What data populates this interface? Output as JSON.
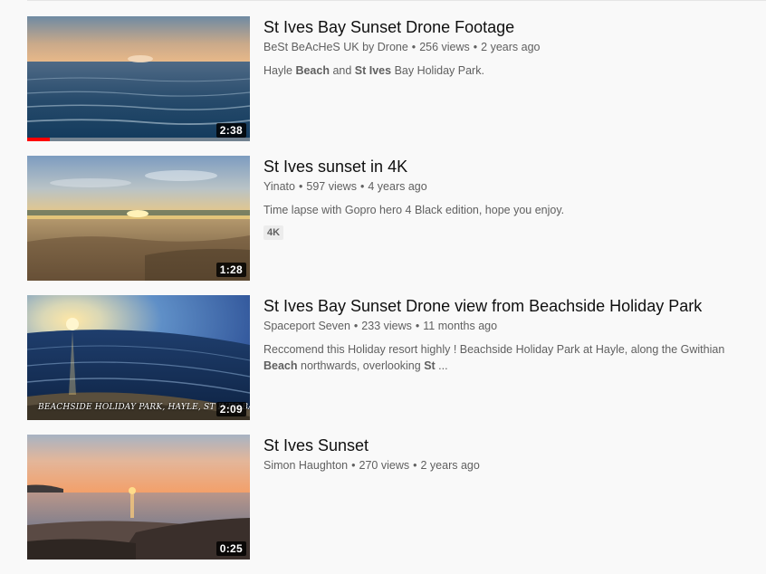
{
  "results": [
    {
      "title": "St Ives Bay Sunset Drone Footage",
      "channel": "BeSt BeAcHeS UK by Drone",
      "views": "256 views",
      "age": "2 years ago",
      "duration": "2:38",
      "watch_progress": 0.1,
      "description": [
        {
          "text": "Hayle ",
          "bold": false
        },
        {
          "text": "Beach",
          "bold": true
        },
        {
          "text": " and ",
          "bold": false
        },
        {
          "text": "St Ives",
          "bold": true
        },
        {
          "text": " Bay Holiday Park.",
          "bold": false
        }
      ]
    },
    {
      "title": "St Ives sunset in 4K",
      "channel": "Yinato",
      "views": "597 views",
      "age": "4 years ago",
      "duration": "1:28",
      "description": [
        {
          "text": "Time lapse with Gopro hero 4 Black edition, hope you enjoy.",
          "bold": false
        }
      ],
      "badge": "4K"
    },
    {
      "title": "St Ives Bay Sunset Drone view from Beachside Holiday Park",
      "channel": "Spaceport Seven",
      "views": "233 views",
      "age": "11 months ago",
      "duration": "2:09",
      "thumbnail_caption": "BEACHSIDE HOLIDAY PARK, HAYLE, ST IVES BAY &",
      "description": [
        {
          "text": "Reccomend this Holiday resort highly ! Beachside Holiday Park at Hayle, along the Gwithian ",
          "bold": false
        },
        {
          "text": "Beach",
          "bold": true
        },
        {
          "text": " northwards, overlooking ",
          "bold": false
        },
        {
          "text": "St",
          "bold": true
        },
        {
          "text": " ...",
          "bold": false
        }
      ]
    },
    {
      "title": "St Ives Sunset",
      "channel": "Simon Haughton",
      "views": "270 views",
      "age": "2 years ago",
      "duration": "0:25"
    }
  ],
  "separator": "•"
}
